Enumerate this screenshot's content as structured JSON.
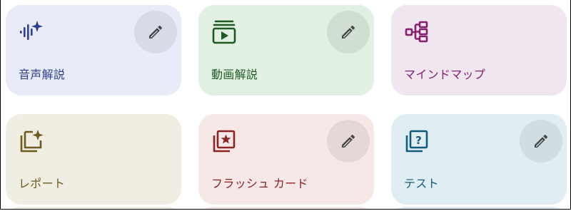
{
  "colors": {
    "audio_bg": "#e9ecf8",
    "audio_fg": "#2e3f8f",
    "video_bg": "#e1f0e2",
    "video_fg": "#1e5b24",
    "mindmap_bg": "#f0e6ef",
    "mindmap_fg": "#85206f",
    "report_bg": "#f0eee2",
    "report_fg": "#6d5a22",
    "flash_bg": "#f6e8e6",
    "flash_fg": "#8c2424",
    "test_bg": "#e0eef4",
    "test_fg": "#0f5d7a",
    "edit_bg": "rgba(0,0,0,0.07)"
  },
  "tiles": [
    {
      "label": "音声解説",
      "icon": "audio-waveform-sparkle-icon",
      "has_edit": true
    },
    {
      "label": "動画解説",
      "icon": "video-stack-play-icon",
      "has_edit": true
    },
    {
      "label": "マインドマップ",
      "icon": "mindmap-tree-icon",
      "has_edit": false
    },
    {
      "label": "レポート",
      "icon": "report-stack-sparkle-icon",
      "has_edit": false
    },
    {
      "label": "フラッシュ カード",
      "icon": "flashcard-star-icon",
      "has_edit": true
    },
    {
      "label": "テスト",
      "icon": "quiz-question-icon",
      "has_edit": true
    }
  ],
  "edit_icon": "pencil-icon"
}
